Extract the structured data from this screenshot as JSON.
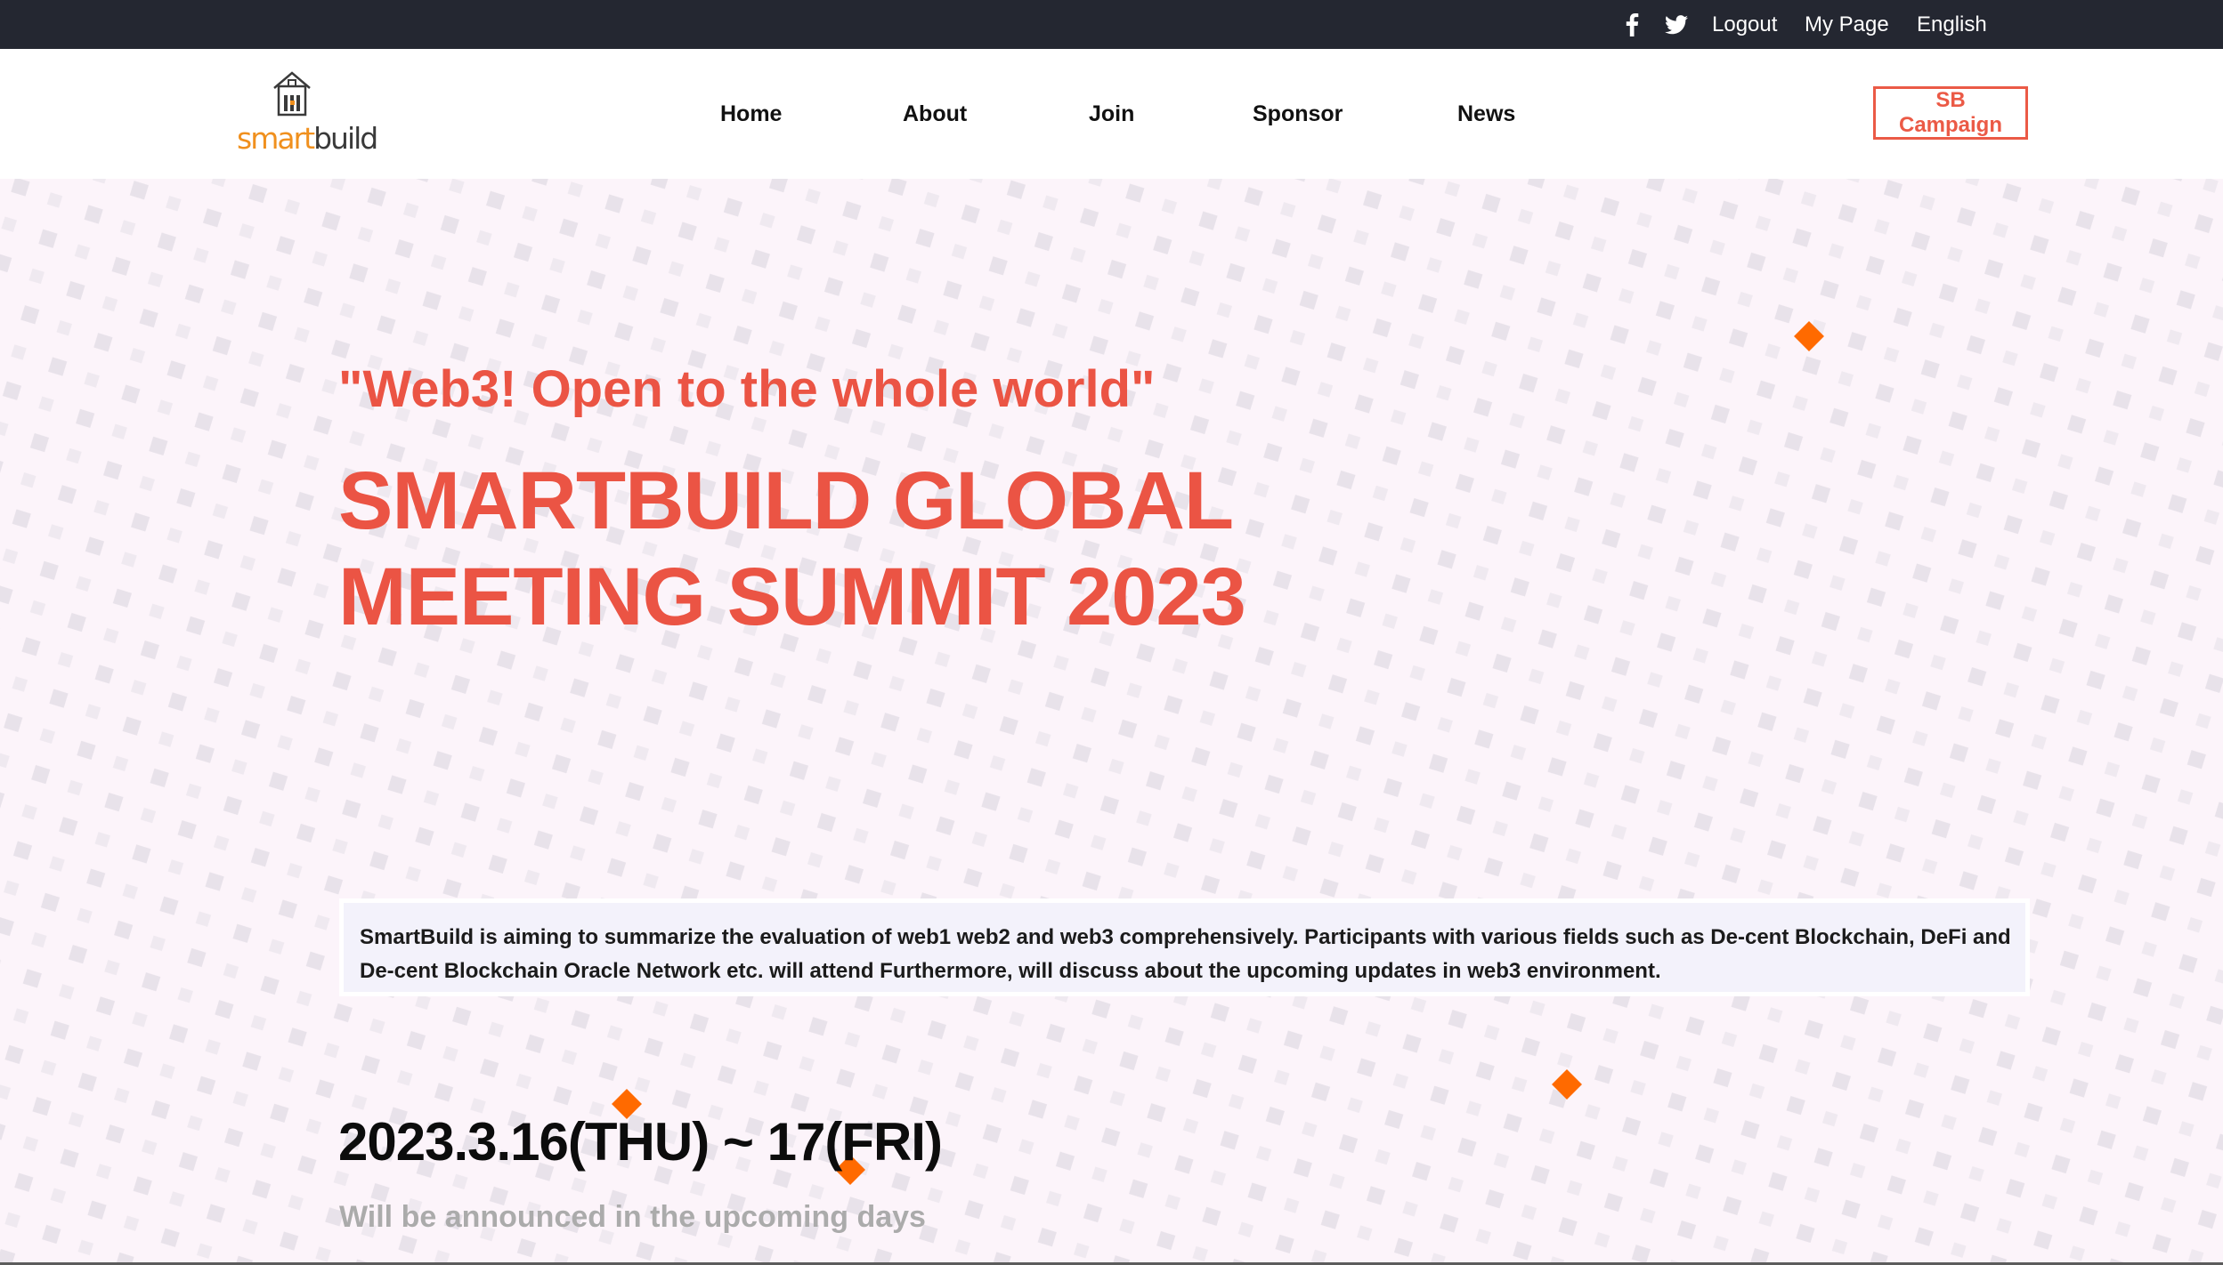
{
  "topbar": {
    "facebook_icon": "facebook-icon",
    "twitter_icon": "twitter-icon",
    "logout": "Logout",
    "mypage": "My Page",
    "language": "English"
  },
  "header": {
    "logo": {
      "part1": "smart",
      "part2": "build"
    },
    "nav": [
      "Home",
      "About",
      "Join",
      "Sponsor",
      "News"
    ],
    "campaign_button": "SB Campaign"
  },
  "hero": {
    "slogan": "\"Web3! Open to the whole world\"",
    "title_line1": "SMARTBUILD GLOBAL",
    "title_line2": "MEETING SUMMIT 2023",
    "description": "SmartBuild is aiming to summarize the evaluation of web1 web2 and web3 comprehensively. Participants with various fields such as De-cent Blockchain, DeFi and De-cent Blockchain Oracle Network etc. will attend Furthermore, will discuss about the upcoming updates in web3 environment.",
    "date": "2023.3.16(THU) ~ 17(FRI)",
    "venue_note": "Will be announced in the upcoming days"
  },
  "colors": {
    "topbar_bg": "#242731",
    "accent": "#eb5444",
    "accent_orange": "#ff6a00",
    "hero_bg": "#fcf4fa",
    "description_bg": "#f3f2fb"
  }
}
